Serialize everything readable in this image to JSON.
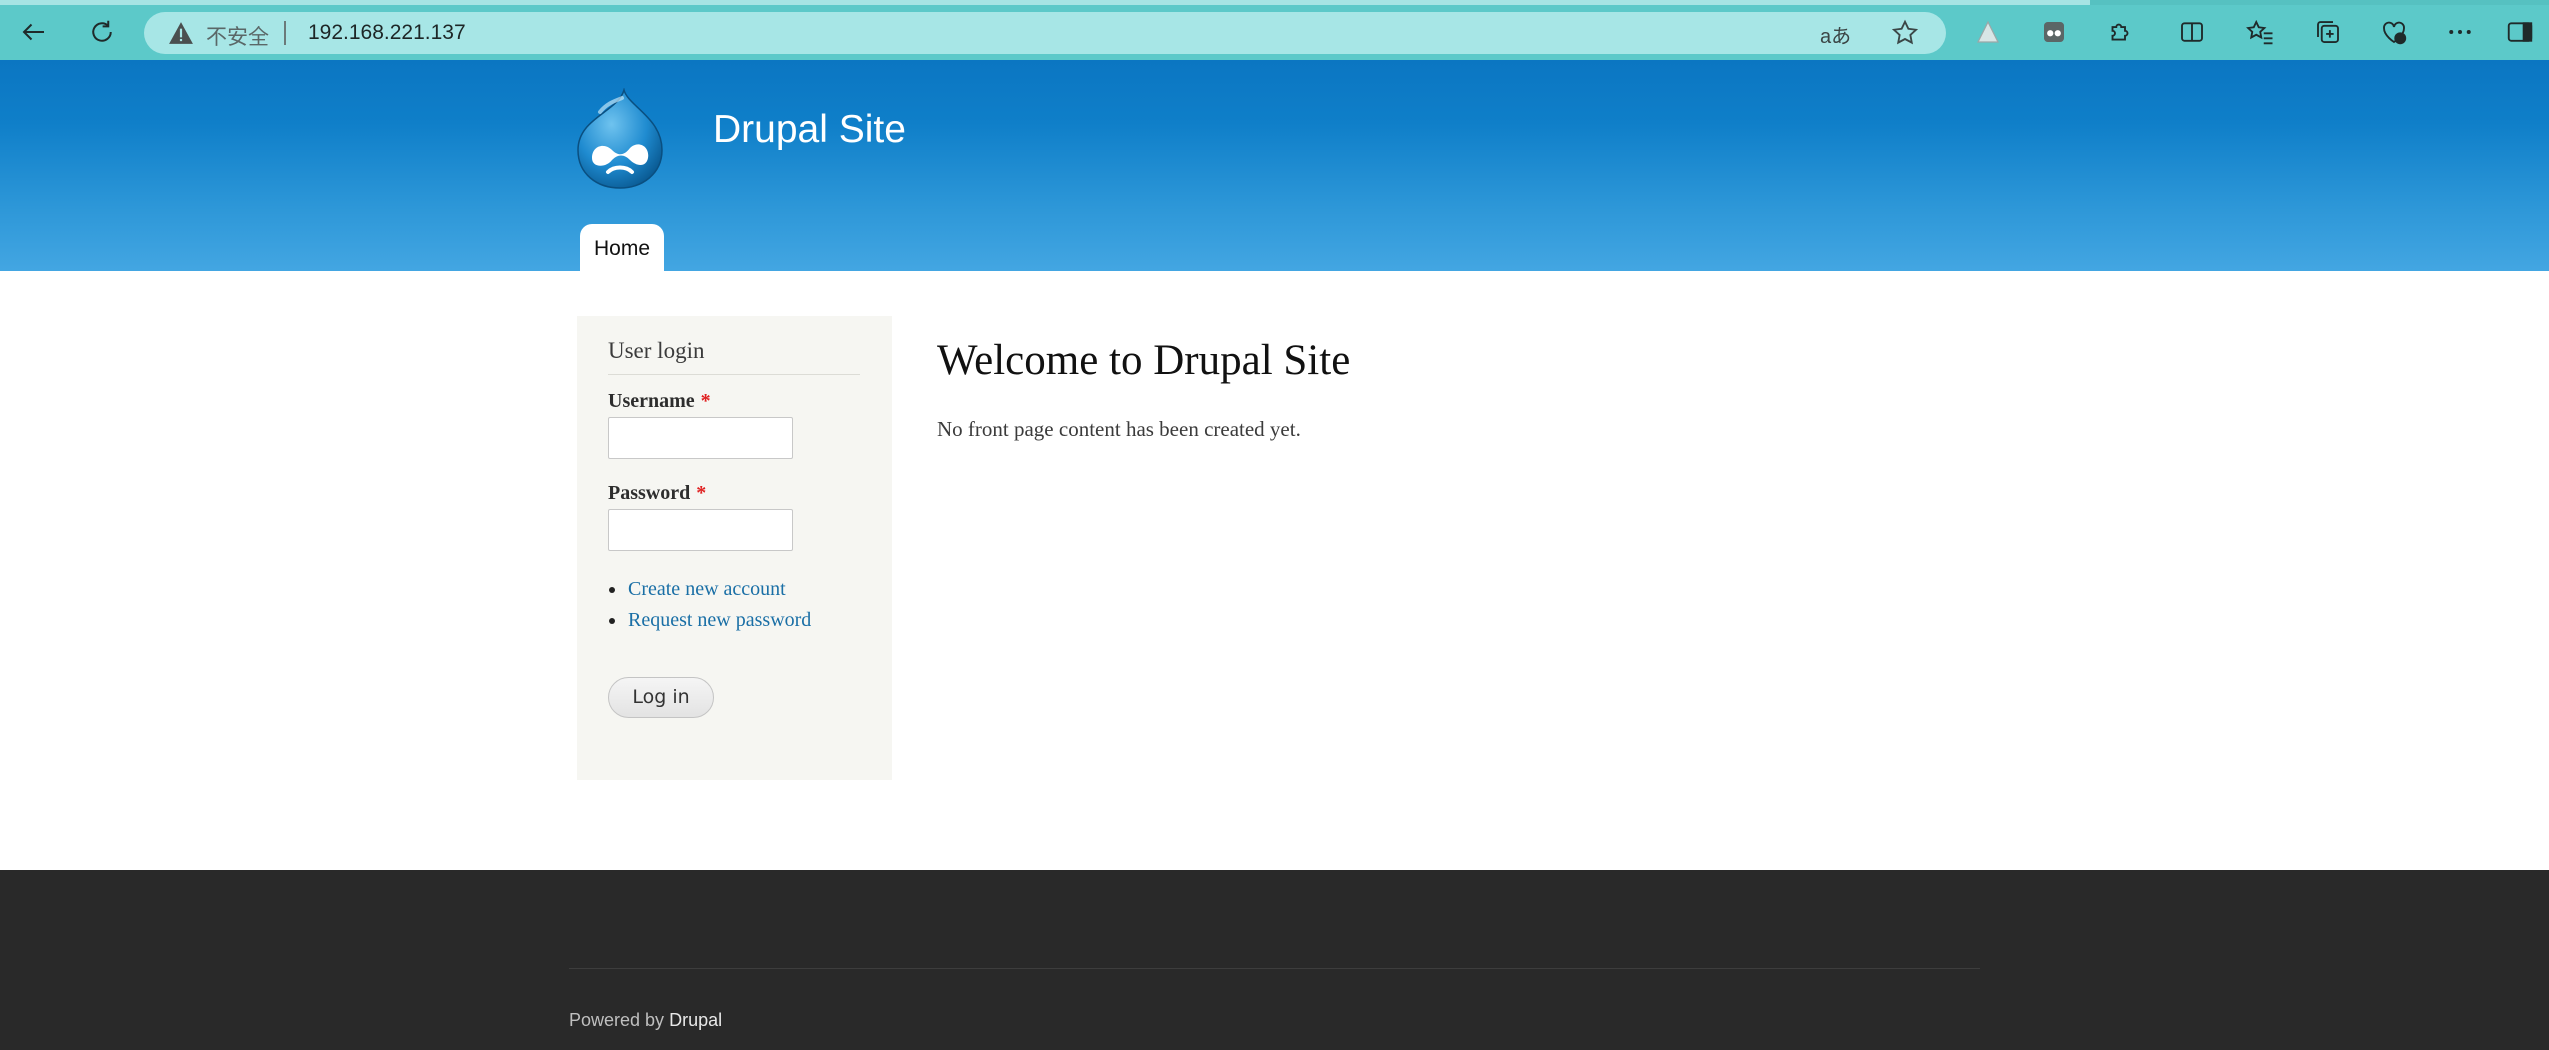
{
  "browser": {
    "security_label": "不安全",
    "url": "192.168.221.137",
    "read_aloud_glyph": "aあ",
    "accent_color": "#5cc9c9"
  },
  "header": {
    "site_name": "Drupal Site",
    "nav": [
      {
        "label": "Home",
        "active": true
      }
    ],
    "brand_color": "#0f7fc9"
  },
  "sidebar": {
    "block_title": "User login",
    "username_label": "Username",
    "password_label": "Password",
    "required_mark": "*",
    "username_value": "",
    "password_value": "",
    "links": [
      "Create new account",
      "Request new password"
    ],
    "login_button": "Log in"
  },
  "main": {
    "title": "Welcome to Drupal Site",
    "text": "No front page content has been created yet."
  },
  "footer": {
    "powered_by": "Powered by",
    "powered_link": "Drupal"
  }
}
